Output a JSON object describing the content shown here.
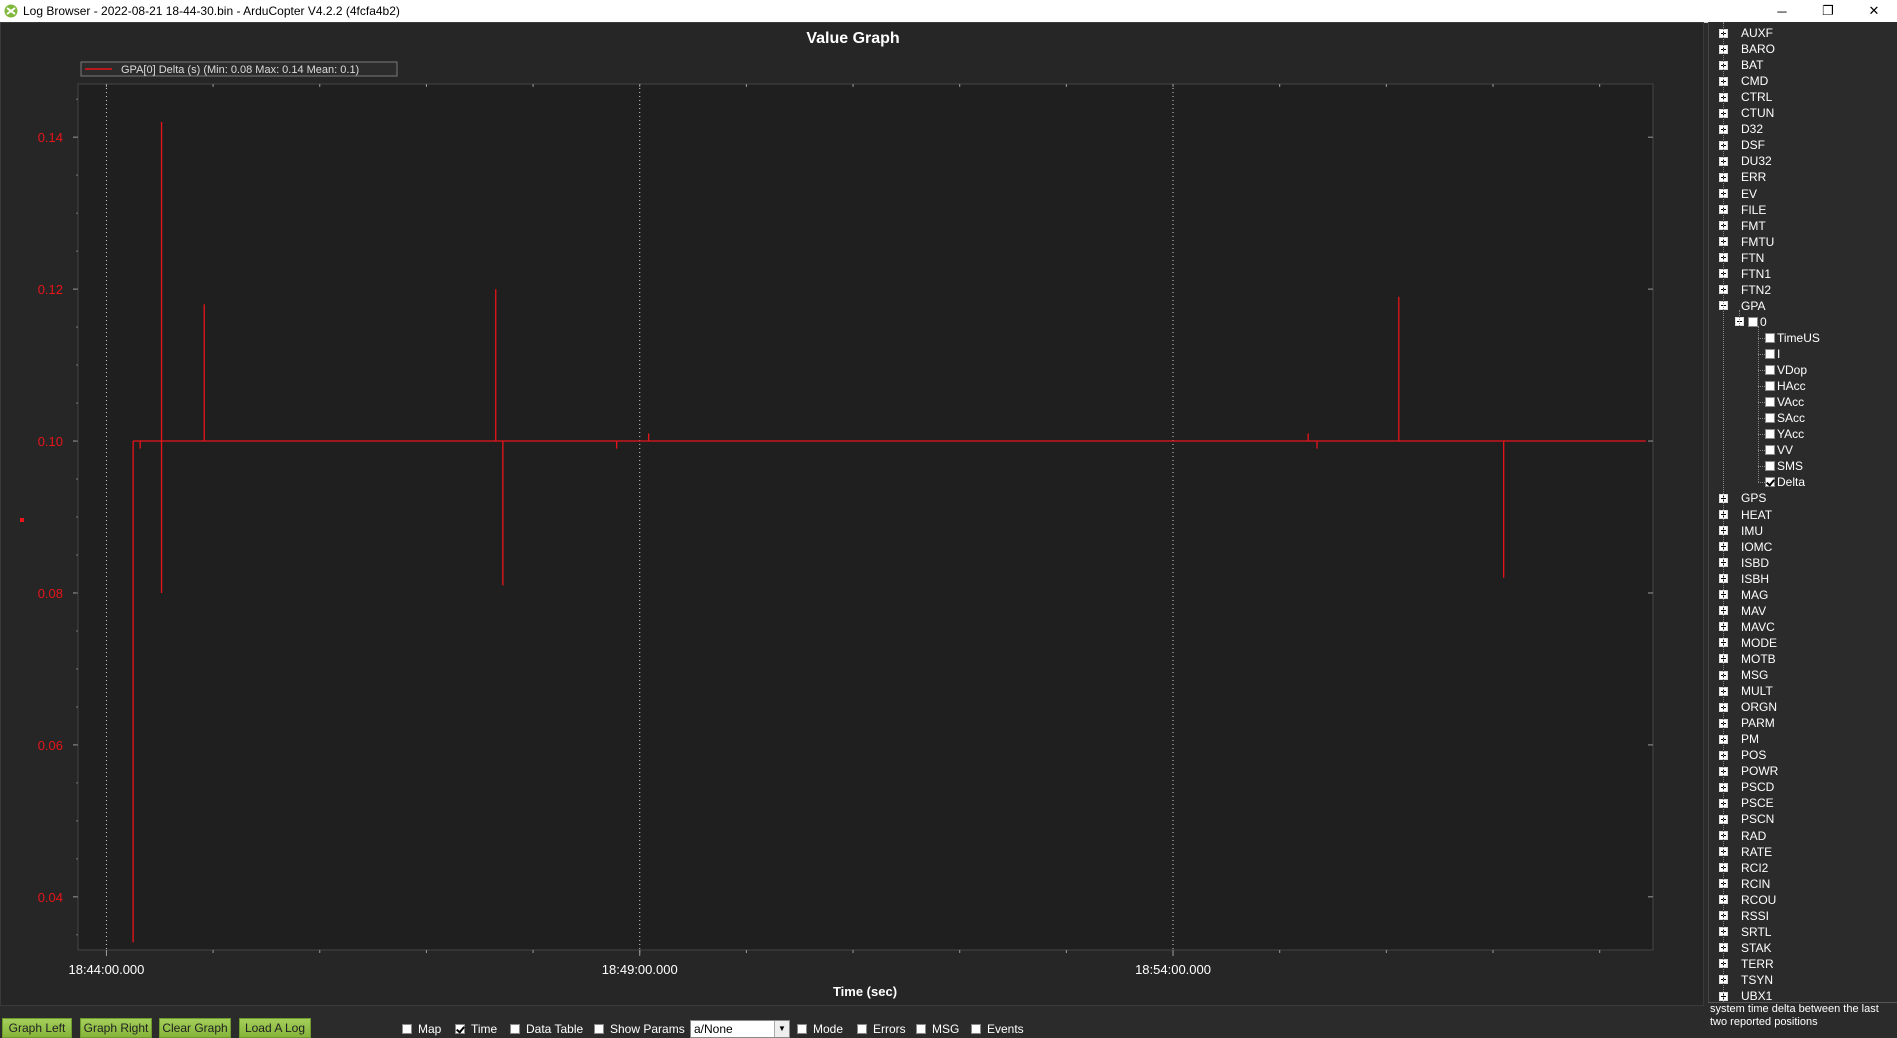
{
  "window": {
    "title": "Log Browser - 2022-08-21 18-44-30.bin - ArduCopter V4.2.2 (4fcfa4b2)",
    "minimize": "─",
    "restore": "❐",
    "close": "✕"
  },
  "graph": {
    "title": "Value Graph",
    "legend": "GPA[0] Delta (s)  (Min: 0.08 Max: 0.14 Mean: 0.1)",
    "legend_color": "#e8141a",
    "xlabel": "Time (sec)"
  },
  "chart_data": {
    "type": "line",
    "title": "Value Graph",
    "xlabel": "Time (sec)",
    "ylabel": "",
    "ylim": [
      0.033,
      0.147
    ],
    "xlim": [
      "18:43:44",
      "18:58:30"
    ],
    "x_ticks": [
      "18:44:00.000",
      "18:49:00.000",
      "18:54:00.000"
    ],
    "y_ticks": [
      "0.04",
      "0.06",
      "0.08",
      "0.10",
      "0.12",
      "0.14"
    ],
    "y_tick_values": [
      0.04,
      0.06,
      0.08,
      0.1,
      0.12,
      0.14
    ],
    "grid": "vertical dotted at major x ticks",
    "series": [
      {
        "name": "GPA[0] Delta (s)",
        "color": "#e8141a",
        "baseline": 0.1,
        "spikes": [
          {
            "t": "18:44:15",
            "low": 0.034,
            "high": 0.1
          },
          {
            "t": "18:44:19",
            "low": 0.099,
            "high": 0.1
          },
          {
            "t": "18:44:31",
            "low": 0.08,
            "high": 0.142
          },
          {
            "t": "18:44:55",
            "low": 0.1,
            "high": 0.118
          },
          {
            "t": "18:47:39",
            "low": 0.1,
            "high": 0.12
          },
          {
            "t": "18:47:43",
            "low": 0.081,
            "high": 0.1
          },
          {
            "t": "18:48:47",
            "low": 0.099,
            "high": 0.1
          },
          {
            "t": "18:49:05",
            "low": 0.1,
            "high": 0.101
          },
          {
            "t": "18:55:16",
            "low": 0.1,
            "high": 0.101
          },
          {
            "t": "18:55:21",
            "low": 0.099,
            "high": 0.1
          },
          {
            "t": "18:56:07",
            "low": 0.1,
            "high": 0.119
          },
          {
            "t": "18:57:06",
            "low": 0.082,
            "high": 0.1
          }
        ]
      }
    ]
  },
  "tree": {
    "items": [
      "AUXF",
      "BARO",
      "BAT",
      "CMD",
      "CTRL",
      "CTUN",
      "D32",
      "DSF",
      "DU32",
      "ERR",
      "EV",
      "FILE",
      "FMT",
      "FMTU",
      "FTN",
      "FTN1",
      "FTN2",
      "GPA"
    ],
    "gpa_instance": "0",
    "gpa_fields": [
      {
        "label": "TimeUS",
        "checked": false
      },
      {
        "label": "I",
        "checked": false
      },
      {
        "label": "VDop",
        "checked": false
      },
      {
        "label": "HAcc",
        "checked": false
      },
      {
        "label": "VAcc",
        "checked": false
      },
      {
        "label": "SAcc",
        "checked": false
      },
      {
        "label": "YAcc",
        "checked": false
      },
      {
        "label": "VV",
        "checked": false
      },
      {
        "label": "SMS",
        "checked": false
      },
      {
        "label": "Delta",
        "checked": true
      }
    ],
    "items_after": [
      "GPS",
      "HEAT",
      "IMU",
      "IOMC",
      "ISBD",
      "ISBH",
      "MAG",
      "MAV",
      "MAVC",
      "MODE",
      "MOTB",
      "MSG",
      "MULT",
      "ORGN",
      "PARM",
      "PM",
      "POS",
      "POWR",
      "PSCD",
      "PSCE",
      "PSCN",
      "RAD",
      "RATE",
      "RCI2",
      "RCIN",
      "RCOU",
      "RSSI",
      "SRTL",
      "STAK",
      "TERR",
      "TSYN",
      "UBX1"
    ],
    "description": "system time delta between the last two reported positions"
  },
  "toolbar": {
    "buttons": [
      "Graph Left",
      "Graph Right",
      "Clear Graph",
      "Load A Log"
    ],
    "checks": [
      {
        "label": "Map",
        "checked": false
      },
      {
        "label": "Time",
        "checked": true
      },
      {
        "label": "Data Table",
        "checked": false
      },
      {
        "label": "Show Params",
        "checked": false
      }
    ],
    "mode_select": "a/None",
    "checks2": [
      {
        "label": "Mode",
        "checked": false
      },
      {
        "label": "Errors",
        "checked": false
      },
      {
        "label": "MSG",
        "checked": false
      },
      {
        "label": "Events",
        "checked": false
      }
    ]
  }
}
